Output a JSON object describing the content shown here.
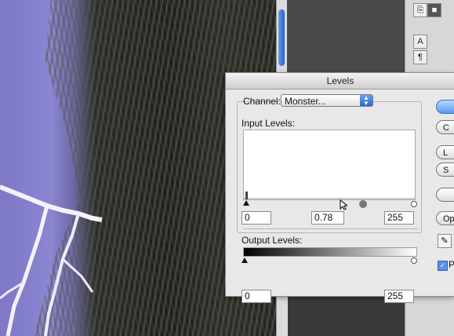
{
  "dialog": {
    "title": "Levels",
    "channel_label": "Channel:",
    "channel_value": "Monster...",
    "input_levels_label": "Input Levels:",
    "input_black": "0",
    "input_gamma": "0.78",
    "input_white": "255",
    "output_levels_label": "Output Levels:",
    "output_black": "0",
    "output_white": "255",
    "buttons": [
      "",
      "C",
      "L",
      "S",
      "",
      "Op"
    ],
    "preview_label": "Pr",
    "preview_checked": "✓"
  },
  "palette": {
    "tool_a": "A",
    "tool_para": "¶"
  }
}
